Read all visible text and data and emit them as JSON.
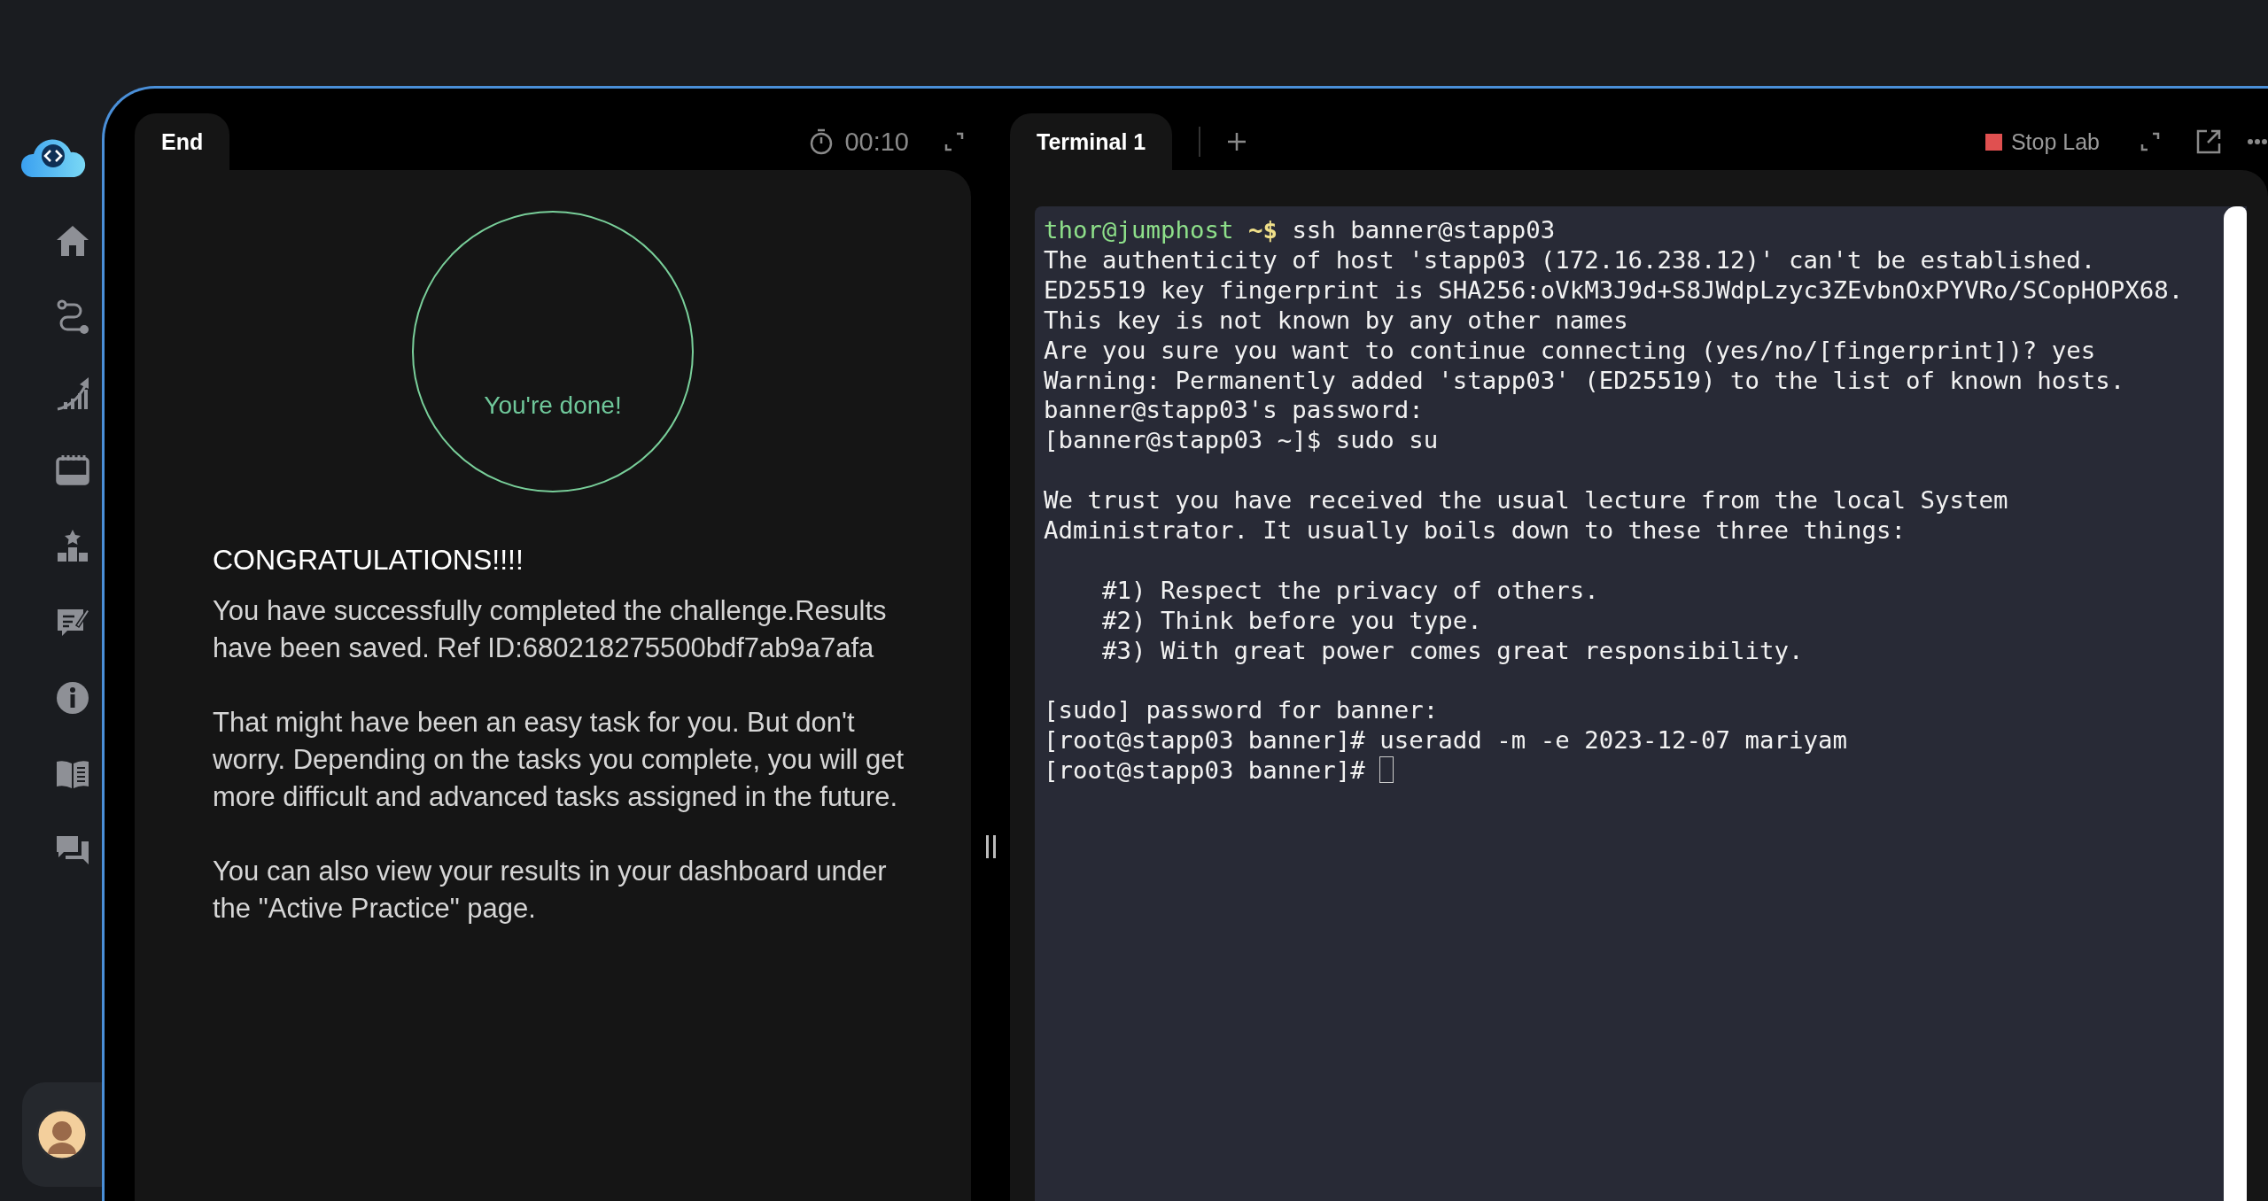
{
  "left_pane": {
    "tab": {
      "label": "End",
      "selected": true
    },
    "timer": "00:10",
    "status": "You're done!",
    "heading": "CONGRATULATIONS!!!!",
    "paragraphs": [
      "You have successfully completed the challenge.Results have been saved. Ref ID:680218275500bdf7ab9a7afa",
      "That might have been an easy task for you. But don't worry. Depending on the tasks you complete, you will get more difficult and advanced tasks assigned in the future.",
      "You can also view your results in your dashboard under the \"Active Practice\" page."
    ]
  },
  "right_pane": {
    "tabs": [
      {
        "label": "Terminal 1",
        "selected": true
      }
    ],
    "stop_button": "Stop Lab",
    "terminal": {
      "cursor": true,
      "blocks": [
        [
          {
            "user": "thor@jumphost",
            "dir": "~$",
            "text": "ssh banner@stapp03"
          },
          {
            "text": "The authenticity of host 'stapp03 (172.16.238.12)' can't be established."
          },
          {
            "text": "ED25519 key fingerprint is SHA256:oVkM3J9d+S8JWdpLzyc3ZEvbnOxPYVRo/SCopHOPX68."
          },
          {
            "text": "This key is not known by any other names"
          },
          {
            "text": "Are you sure you want to continue connecting (yes/no/[fingerprint])? yes"
          },
          {
            "text": "Warning: Permanently added 'stapp03' (ED25519) to the list of known hosts."
          },
          {
            "text": "banner@stapp03's password:"
          },
          {
            "text": "[banner@stapp03 ~]$ sudo su"
          }
        ],
        [
          {
            "text": "We trust you have received the usual lecture from the local System"
          },
          {
            "text": "Administrator. It usually boils down to these three things:"
          }
        ],
        [
          {
            "text": "    #1) Respect the privacy of others."
          },
          {
            "text": "    #2) Think before you type."
          },
          {
            "text": "    #3) With great power comes great responsibility."
          }
        ],
        [
          {
            "text": "[sudo] password for banner:"
          },
          {
            "text": "[root@stapp03 banner]# useradd -m -e 2023-12-07 mariyam"
          },
          {
            "text": "[root@stapp03 banner]#"
          }
        ]
      ]
    }
  }
}
